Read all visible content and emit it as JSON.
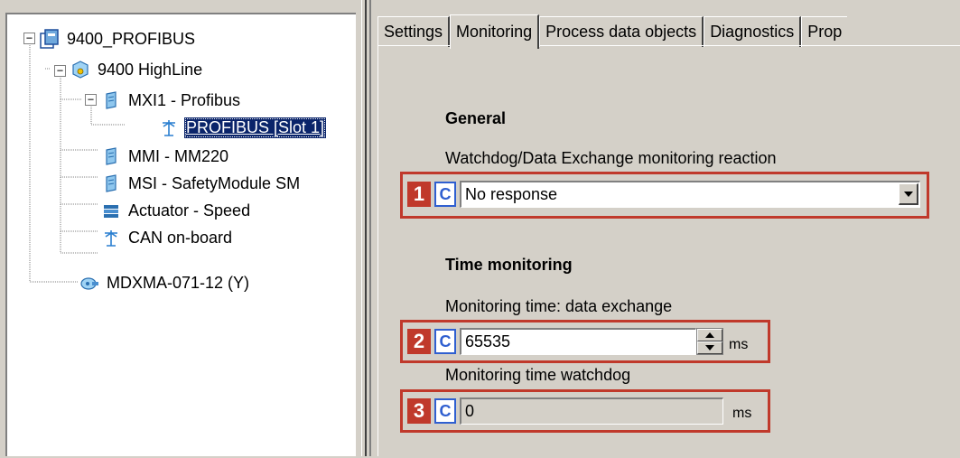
{
  "tree": {
    "nodes": [
      {
        "label": "9400_PROFIBUS",
        "icon": "project-icon"
      },
      {
        "label": "9400 HighLine",
        "icon": "controller-icon"
      },
      {
        "label": "MXI1 - Profibus",
        "icon": "module-icon"
      },
      {
        "label": "PROFIBUS [Slot 1]",
        "icon": "network-icon"
      },
      {
        "label": "MMI - MM220",
        "icon": "module-icon"
      },
      {
        "label": "MSI - SafetyModule SM",
        "icon": "module-icon"
      },
      {
        "label": "Actuator - Speed",
        "icon": "actuator-icon"
      },
      {
        "label": "CAN on-board",
        "icon": "network-icon"
      },
      {
        "label": "MDXMA-071-12 (Y)",
        "icon": "motor-icon"
      }
    ],
    "expander_minus": "−"
  },
  "tabs": [
    "Settings",
    "Monitoring",
    "Process data objects",
    "Diagnostics",
    "Prop"
  ],
  "general": {
    "heading": "General",
    "label": "Watchdog/Data Exchange monitoring reaction",
    "badge": "1",
    "c_label": "C",
    "selected_value": "No response"
  },
  "time_monitoring": {
    "heading": "Time monitoring",
    "data_exchange": {
      "label": "Monitoring time: data exchange",
      "badge": "2",
      "c_label": "C",
      "value": "65535",
      "unit": "ms"
    },
    "watchdog": {
      "label": "Monitoring time watchdog",
      "badge": "3",
      "c_label": "C",
      "value": "0",
      "unit": "ms"
    }
  },
  "colors": {
    "highlight": "#c0392b",
    "selection": "#0a246a",
    "c_button": "#2f5fd0"
  }
}
